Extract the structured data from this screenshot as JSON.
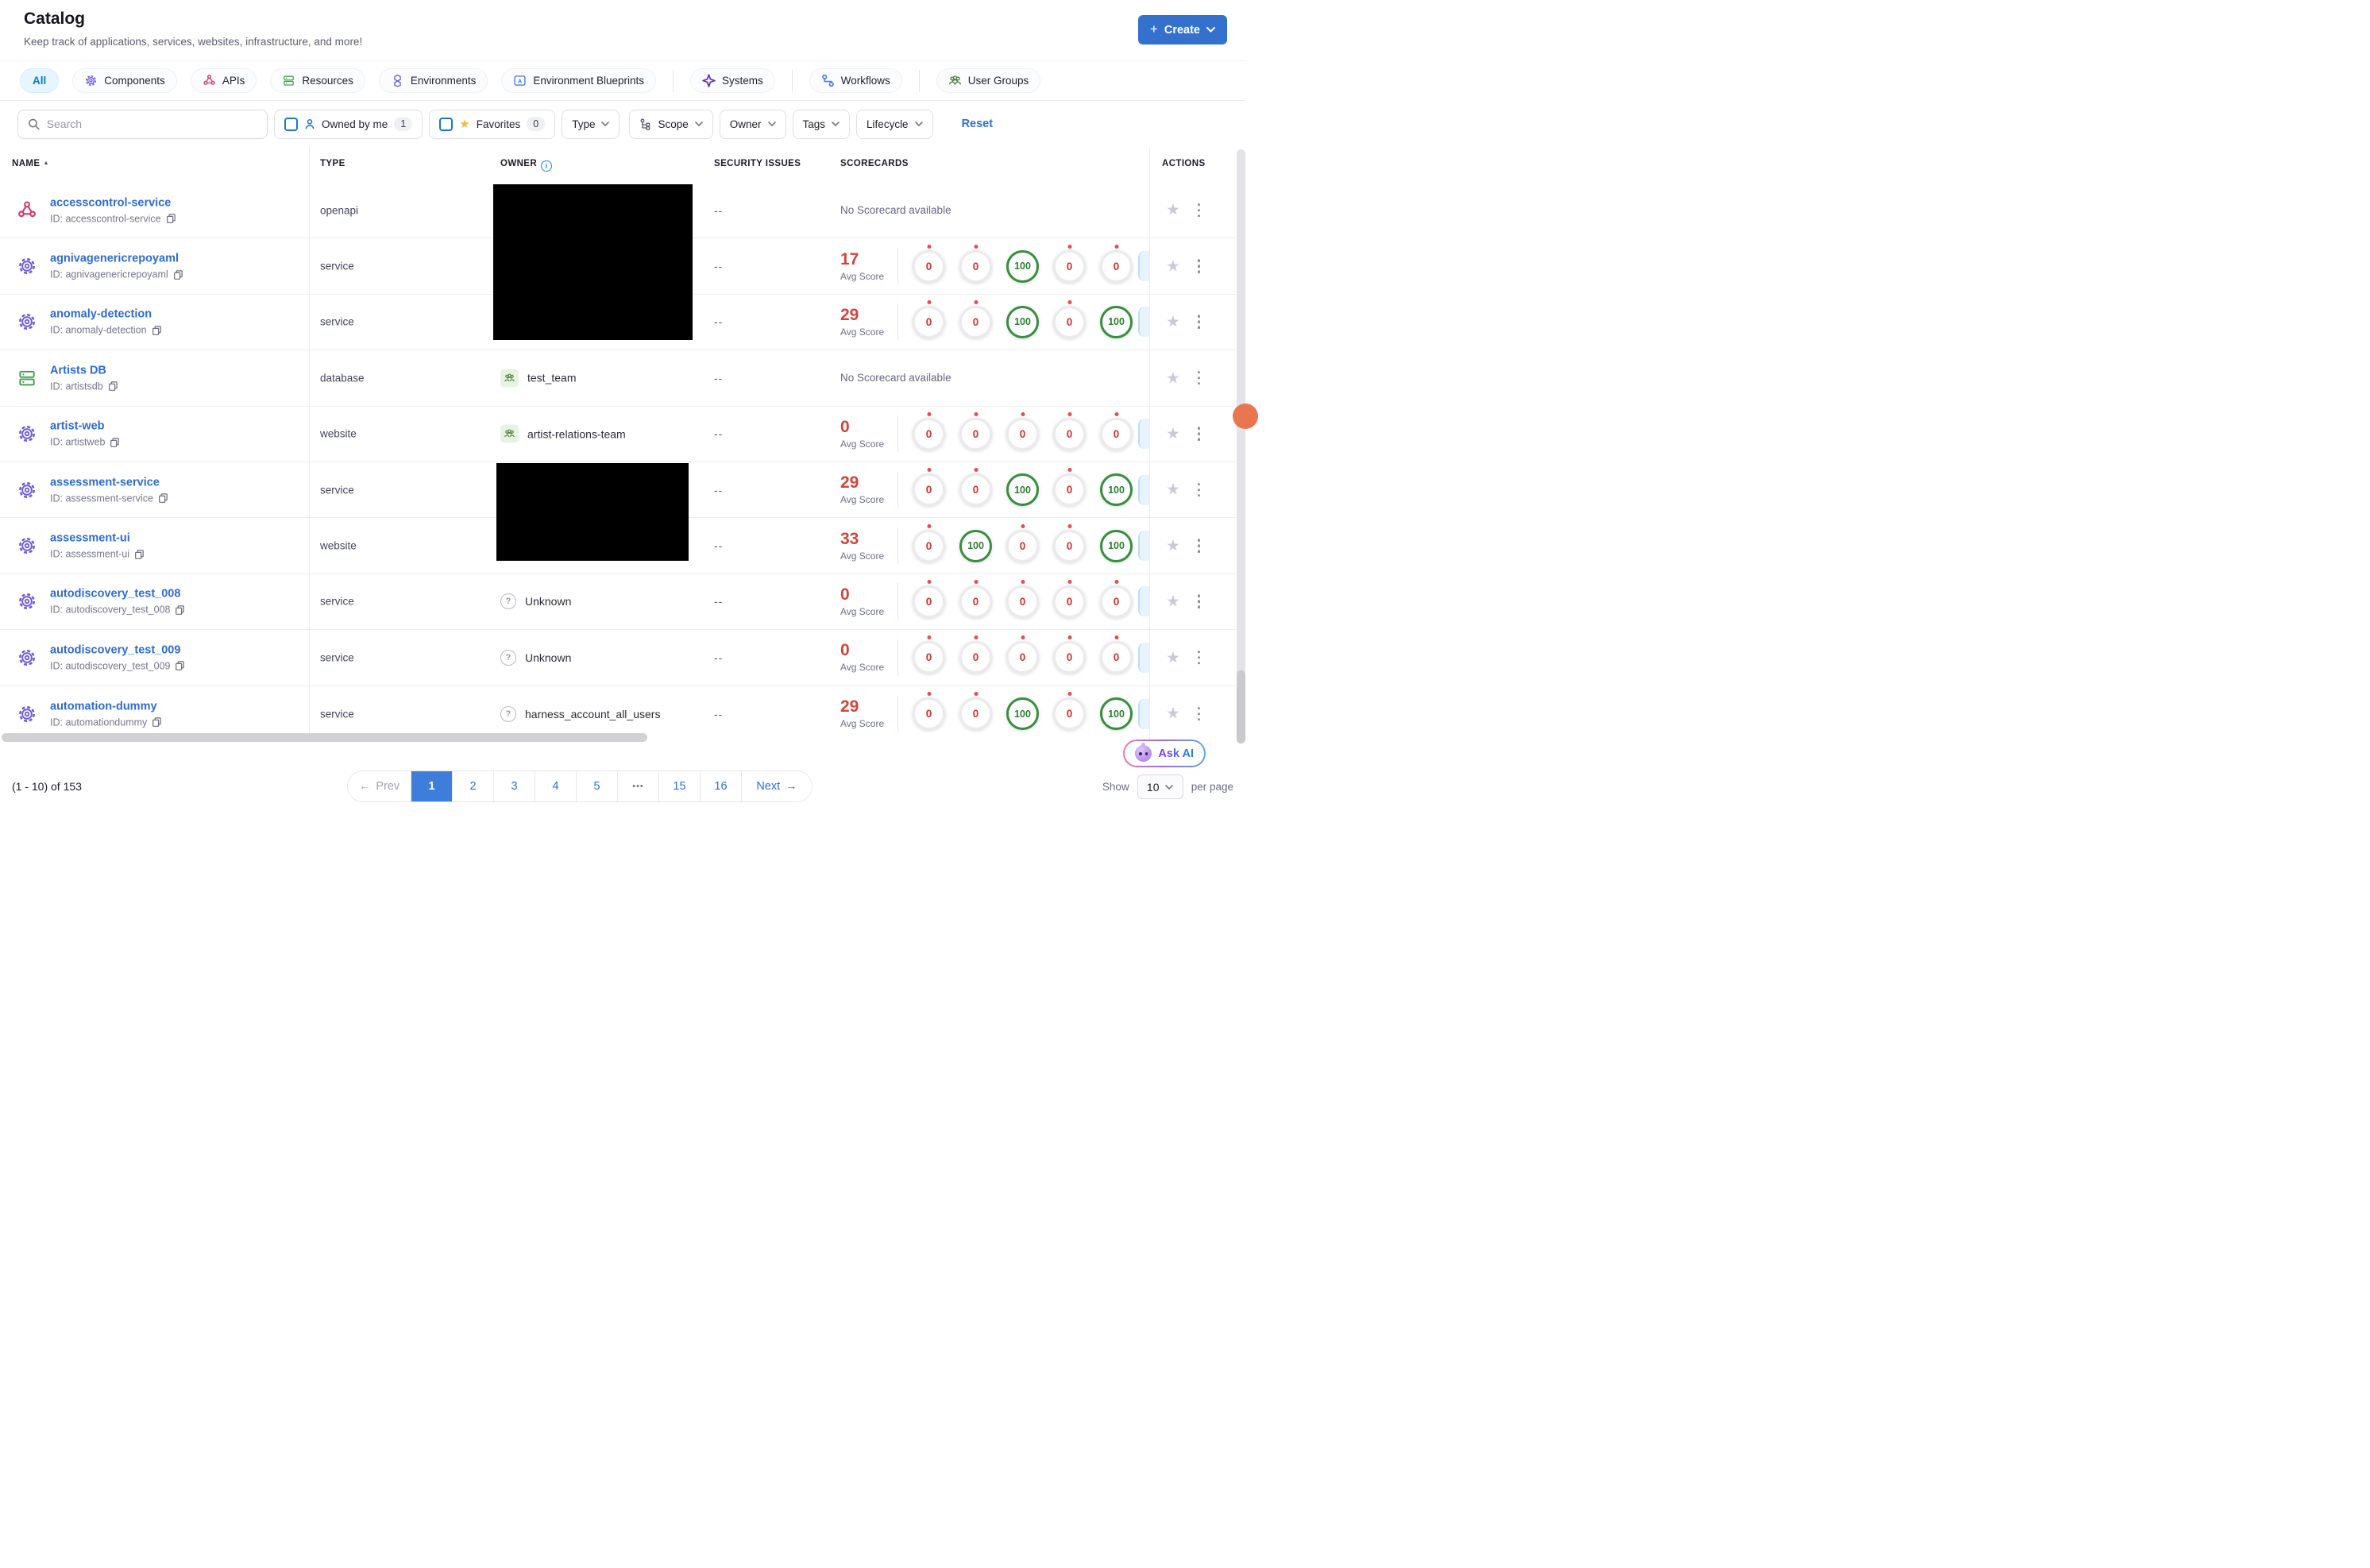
{
  "colors": {
    "brand_blue": "#3470cd",
    "link_blue": "#2e6bd2",
    "active_tab_blue": "#0b78c8",
    "score_red": "#d0342c",
    "score_green": "#388e3c"
  },
  "header": {
    "title": "Catalog",
    "subtitle": "Keep track of applications, services, websites, infrastructure, and more!",
    "create_label": "Create"
  },
  "tabs": [
    {
      "label": "All"
    },
    {
      "label": "Components"
    },
    {
      "label": "APIs"
    },
    {
      "label": "Resources"
    },
    {
      "label": "Environments"
    },
    {
      "label": "Environment Blueprints"
    },
    {
      "label": "Systems"
    },
    {
      "label": "Workflows"
    },
    {
      "label": "User Groups"
    }
  ],
  "filters": {
    "search_placeholder": "Search",
    "owned_by_me": {
      "label": "Owned by me",
      "count": "1"
    },
    "favorites": {
      "label": "Favorites",
      "count": "0"
    },
    "type_label": "Type",
    "scope_label": "Scope",
    "owner_label": "Owner",
    "tags_label": "Tags",
    "lifecycle_label": "Lifecycle",
    "reset_label": "Reset"
  },
  "table": {
    "columns": {
      "name": "NAME",
      "type": "TYPE",
      "owner": "OWNER",
      "security": "SECURITY ISSUES",
      "scorecards": "SCORECARDS",
      "actions": "ACTIONS"
    },
    "no_scorecard_label": "No Scorecard available",
    "avg_label": "Avg Score",
    "rows": [
      {
        "name": "accesscontrol-service",
        "id": "ID: accesscontrol-service",
        "type": "openapi",
        "security": "--"
      },
      {
        "name": "agnivagenericrepoyaml",
        "id": "ID: agnivagenericrepoyaml",
        "type": "service",
        "security": "--",
        "avg": "17",
        "scores": [
          "0",
          "0",
          "100",
          "0",
          "0"
        ]
      },
      {
        "name": "anomaly-detection",
        "id": "ID: anomaly-detection",
        "type": "service",
        "security": "--",
        "avg": "29",
        "scores": [
          "0",
          "0",
          "100",
          "0",
          "100"
        ]
      },
      {
        "name": "Artists DB",
        "id": "ID: artistsdb",
        "type": "database",
        "owner": "test_team",
        "security": "--"
      },
      {
        "name": "artist-web",
        "id": "ID: artistweb",
        "type": "website",
        "owner": "artist-relations-team",
        "security": "--",
        "avg": "0",
        "scores": [
          "0",
          "0",
          "0",
          "0",
          "0"
        ]
      },
      {
        "name": "assessment-service",
        "id": "ID: assessment-service",
        "type": "service",
        "security": "--",
        "avg": "29",
        "scores": [
          "0",
          "0",
          "100",
          "0",
          "100"
        ]
      },
      {
        "name": "assessment-ui",
        "id": "ID: assessment-ui",
        "type": "website",
        "security": "--",
        "avg": "33",
        "scores": [
          "0",
          "100",
          "0",
          "0",
          "100"
        ]
      },
      {
        "name": "autodiscovery_test_008",
        "id": "ID: autodiscovery_test_008",
        "type": "service",
        "owner": "Unknown",
        "security": "--",
        "avg": "0",
        "scores": [
          "0",
          "0",
          "0",
          "0",
          "0"
        ]
      },
      {
        "name": "autodiscovery_test_009",
        "id": "ID: autodiscovery_test_009",
        "type": "service",
        "owner": "Unknown",
        "security": "--",
        "avg": "0",
        "scores": [
          "0",
          "0",
          "0",
          "0",
          "0"
        ]
      },
      {
        "name": "automation-dummy",
        "id": "ID: automationdummy",
        "type": "service",
        "owner": "harness_account_all_users",
        "security": "--",
        "avg": "29",
        "scores": [
          "0",
          "0",
          "100",
          "0",
          "100"
        ]
      }
    ]
  },
  "pagination": {
    "prev_label": "Prev",
    "next_label": "Next",
    "pages": [
      "1",
      "2",
      "3",
      "4",
      "5",
      "•••",
      "15",
      "16"
    ],
    "active_page": "1"
  },
  "footer": {
    "range_text": "(1 - 10) of 153",
    "show_label": "Show",
    "page_size": "10",
    "per_page_label": "per page",
    "ask_ai_label": "Ask AI"
  }
}
